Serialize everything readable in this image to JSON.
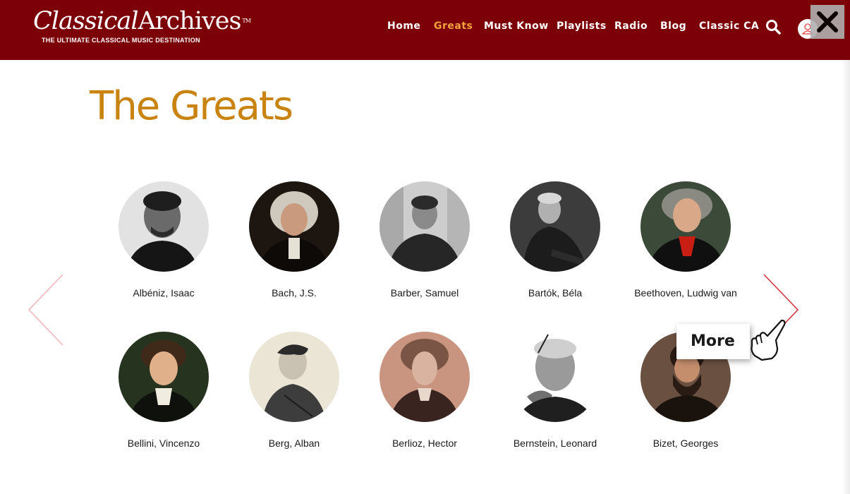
{
  "header": {
    "logo_part1": "Classical",
    "logo_part2": "Archives",
    "logo_tm": "TM",
    "logo_tagline": "THE ULTIMATE CLASSICAL MUSIC DESTINATION",
    "nav": [
      {
        "label": "Home",
        "active": false
      },
      {
        "label": "Greats",
        "active": true
      },
      {
        "label": "Must Know",
        "active": false
      },
      {
        "label": "Playlists",
        "active": false
      },
      {
        "label": "Radio",
        "active": false
      },
      {
        "label": "Blog",
        "active": false
      },
      {
        "label": "Classic CA",
        "active": false
      }
    ],
    "icons": [
      "search-icon",
      "user-icon",
      "close-icon"
    ]
  },
  "main": {
    "title": "The Greats",
    "composers": [
      {
        "name": "Albéniz, Isaac"
      },
      {
        "name": "Bach, J.S."
      },
      {
        "name": "Barber, Samuel"
      },
      {
        "name": "Bartók, Béla"
      },
      {
        "name": "Beethoven, Ludwig van"
      },
      {
        "name": "Bellini, Vincenzo"
      },
      {
        "name": "Berg, Alban"
      },
      {
        "name": "Berlioz, Hector"
      },
      {
        "name": "Bernstein, Leonard"
      },
      {
        "name": "Bizet, Georges"
      }
    ],
    "prev_icon": "chevron-left-icon",
    "next_icon": "chevron-right-icon"
  },
  "overlay": {
    "more_label": "More",
    "hand_icon": "pointing-hand-icon"
  },
  "colors": {
    "header_bg": "#7b0008",
    "accent": "#c88311",
    "nav_active": "#f2a23c",
    "arrow": "#d0343c"
  }
}
